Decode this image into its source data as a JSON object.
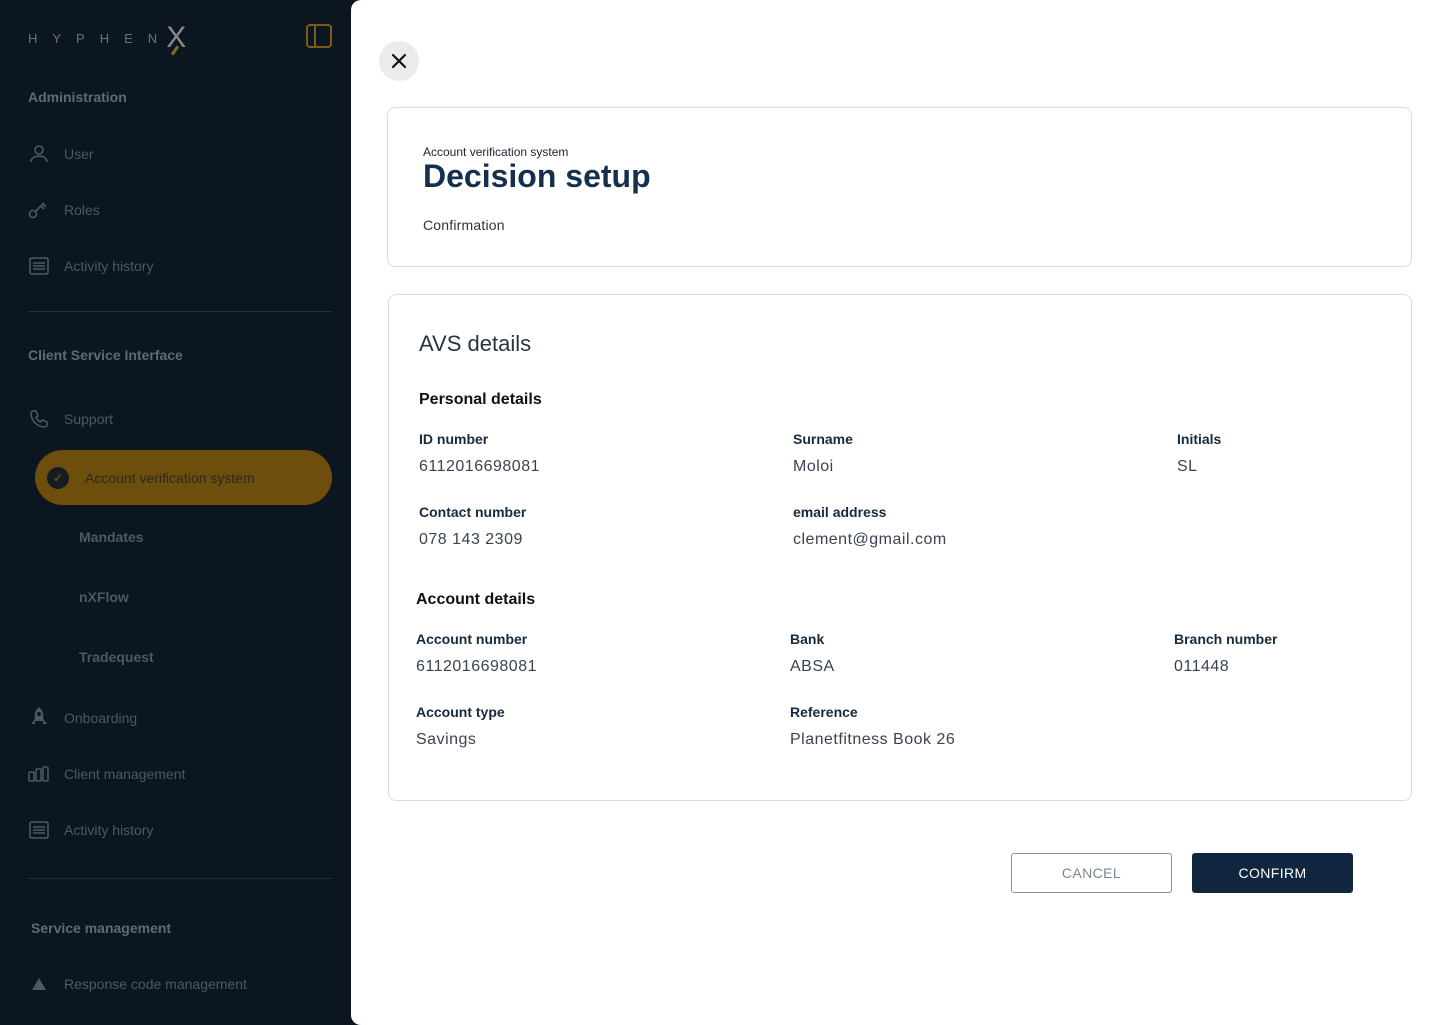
{
  "sidebar": {
    "logo_text": "HYPHEN",
    "logo_mark": "X",
    "sections": {
      "administration": "Administration",
      "client_service": "Client Service Interface",
      "service_management": "Service management"
    },
    "admin_items": [
      {
        "label": "User",
        "icon": "user-icon"
      },
      {
        "label": "Roles",
        "icon": "key-icon"
      },
      {
        "label": "Activity history",
        "icon": "list-icon"
      }
    ],
    "client_items": {
      "support": "Support",
      "active": "Account verification system",
      "sub": [
        "Mandates",
        "nXFlow",
        "Tradequest"
      ],
      "onboarding": "Onboarding",
      "client_management": "Client management",
      "activity_history": "Activity history"
    },
    "service_items": {
      "response_codes": "Response code management"
    }
  },
  "modal": {
    "breadcrumb": "Account verification system",
    "title": "Decision setup",
    "step": "Confirmation",
    "details_title": "AVS details",
    "personal": {
      "title": "Personal details",
      "id_label": "ID number",
      "id_value": "6112016698081",
      "surname_label": "Surname",
      "surname_value": "Moloi",
      "initials_label": "Initials",
      "initials_value": "SL",
      "contact_label": "Contact number",
      "contact_value": "078 143 2309",
      "email_label": "email address",
      "email_value": "clement@gmail.com"
    },
    "account": {
      "title": "Account details",
      "number_label": "Account number",
      "number_value": "6112016698081",
      "bank_label": "Bank",
      "bank_value": "ABSA",
      "branch_label": "Branch number",
      "branch_value": "011448",
      "type_label": "Account type",
      "type_value": "Savings",
      "reference_label": "Reference",
      "reference_value": "Planetfitness Book 26"
    },
    "cancel_label": "CANCEL",
    "confirm_label": "CONFIRM"
  },
  "colors": {
    "sidebar_bg": "#0c1620",
    "accent": "#e0a526",
    "primary": "#10263f"
  }
}
